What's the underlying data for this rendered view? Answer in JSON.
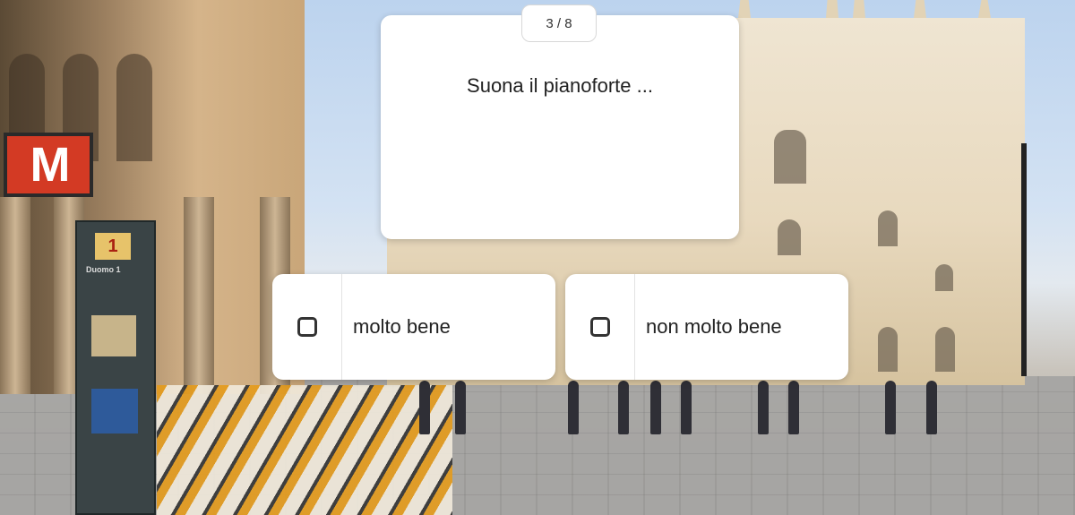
{
  "quiz": {
    "progress": "3 / 8",
    "question": "Suona il pianoforte ...",
    "answers": [
      {
        "label": "molto bene",
        "checked": false
      },
      {
        "label": "non molto bene",
        "checked": false
      }
    ]
  },
  "background": {
    "metro_sign": "M",
    "kiosk_number": "1",
    "kiosk_label": "Duomo 1"
  }
}
